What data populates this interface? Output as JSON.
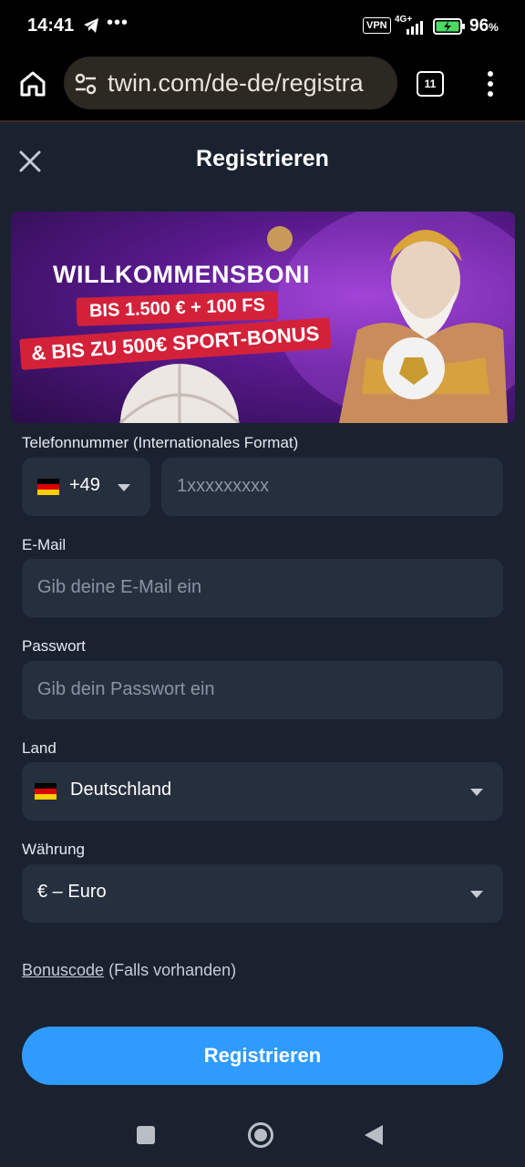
{
  "status_bar": {
    "time": "14:41",
    "more": "•••",
    "vpn": "VPN",
    "network": "4G+",
    "battery": "96",
    "battery_unit": "%"
  },
  "browser": {
    "url": "twin.com/de-de/registra",
    "tab_count": "11"
  },
  "header": {
    "title": "Registrieren"
  },
  "banner": {
    "heading": "WILLKOMMENSBONI",
    "line1": "BIS 1.500 € + 100 FS",
    "line2": "& BIS ZU 500€ SPORT-BONUS"
  },
  "form": {
    "phone": {
      "label": "Telefonnummer (Internationales Format)",
      "country_code": "+49",
      "placeholder": "1xxxxxxxxx"
    },
    "email": {
      "label": "E-Mail",
      "placeholder": "Gib deine E-Mail ein"
    },
    "password": {
      "label": "Passwort",
      "placeholder": "Gib dein Passwort ein"
    },
    "country": {
      "label": "Land",
      "value": "Deutschland"
    },
    "currency": {
      "label": "Währung",
      "value": "€ – Euro"
    },
    "bonus": {
      "link": "Bonuscode",
      "suffix": " (Falls vorhanden)"
    },
    "submit_label": "Registrieren"
  },
  "colors": {
    "background": "#1a2230",
    "input": "#252f3e",
    "accent": "#2f9bff",
    "banner_red": "#d4213a"
  }
}
